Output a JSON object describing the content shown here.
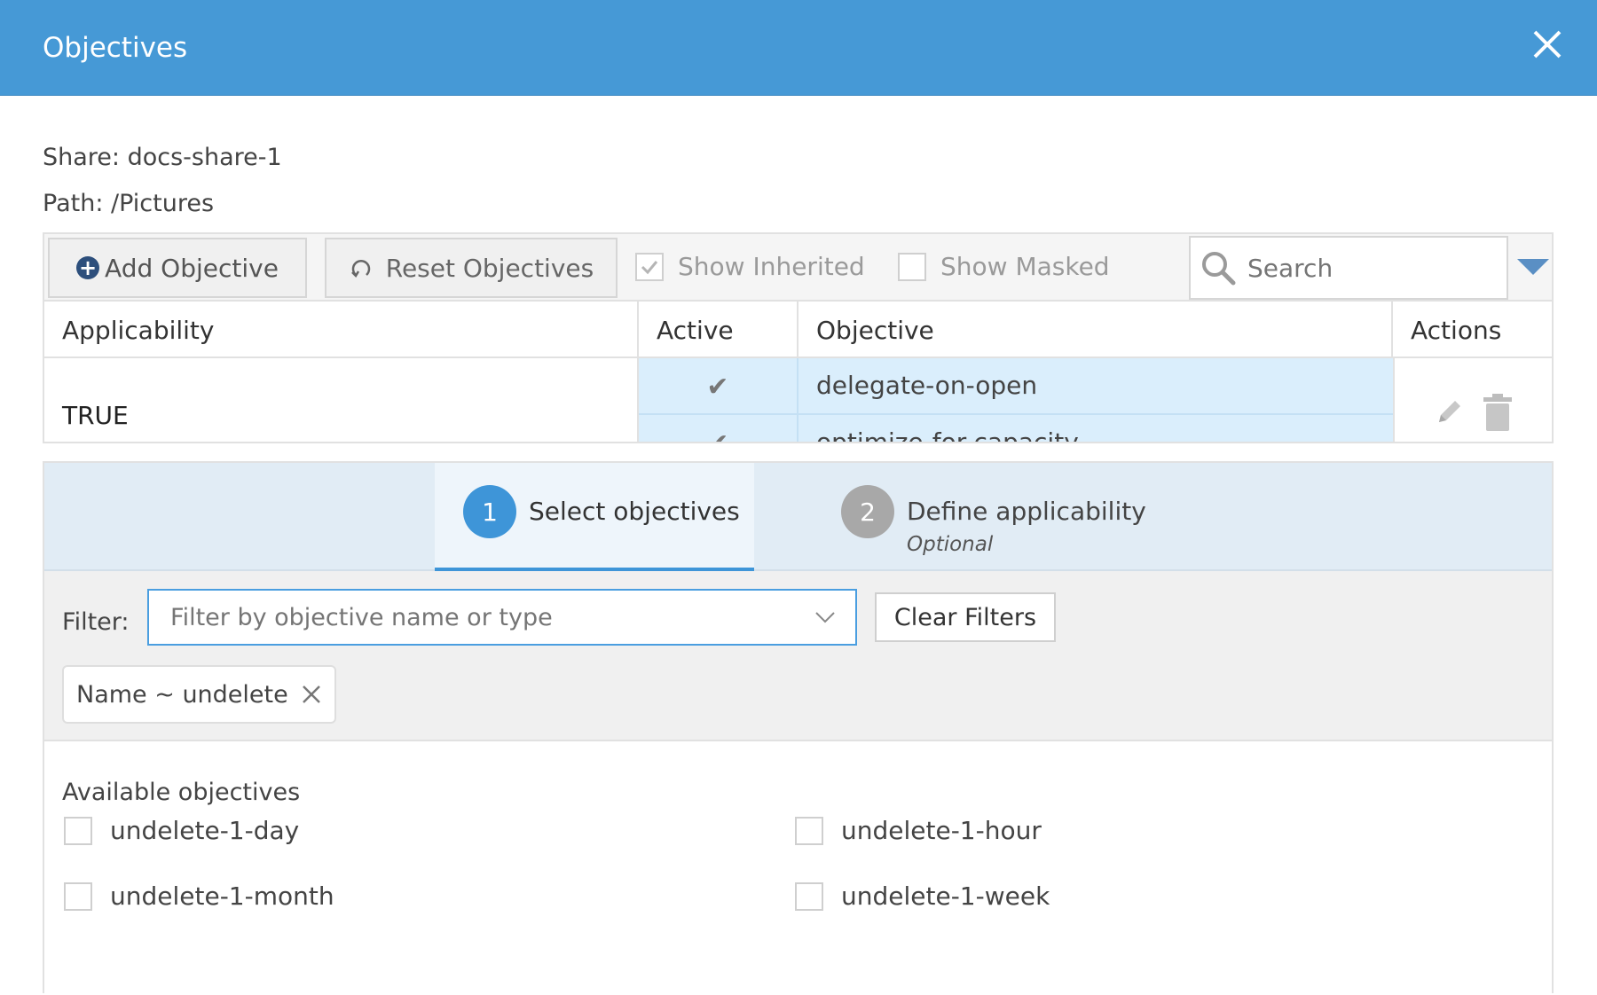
{
  "dialog": {
    "title": "Objectives"
  },
  "info": {
    "share_label": "Share: docs-share-1",
    "path_label": "Path: /Pictures"
  },
  "toolbar": {
    "add_label": "Add Objective",
    "reset_label": "Reset Objectives",
    "show_inherited_label": "Show Inherited",
    "show_inherited_checked": true,
    "show_masked_label": "Show Masked",
    "show_masked_checked": false,
    "search_placeholder": "Search"
  },
  "table": {
    "columns": [
      "Applicability",
      "Active",
      "Objective",
      "Actions"
    ],
    "rows": [
      {
        "applicability": "TRUE",
        "objectives": [
          {
            "active": "✔",
            "name": "delegate-on-open"
          },
          {
            "active": "✔",
            "name": "optimize-for-capacity"
          }
        ]
      }
    ]
  },
  "wizard": {
    "steps": [
      {
        "number": "1",
        "label": "Select objectives",
        "sublabel": ""
      },
      {
        "number": "2",
        "label": "Define applicability",
        "sublabel": "Optional"
      }
    ],
    "filter_label": "Filter:",
    "filter_placeholder": "Filter by objective name or type",
    "clear_filters_label": "Clear Filters",
    "active_filter_chip": "Name ~ undelete",
    "available_title": "Available objectives",
    "available_objectives": [
      "undelete-1-day",
      "undelete-1-hour",
      "undelete-1-month",
      "undelete-1-week"
    ]
  },
  "colors": {
    "header_bg": "#4699d6",
    "accent": "#3e95d8",
    "selected_row": "#daeefc"
  }
}
